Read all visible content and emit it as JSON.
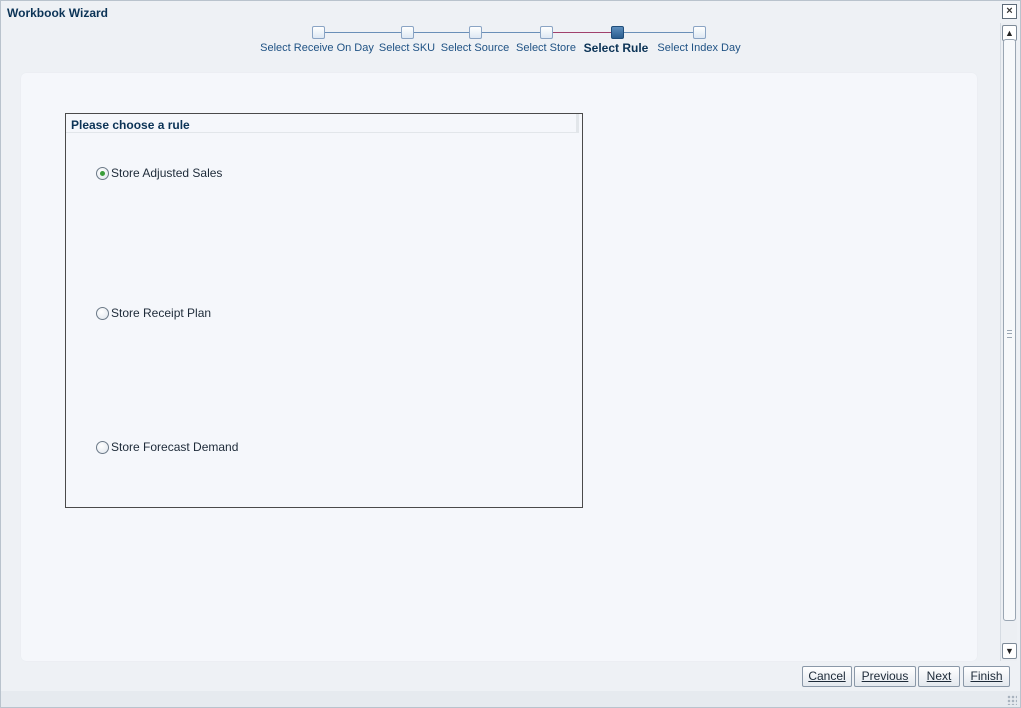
{
  "window": {
    "title": "Workbook Wizard",
    "close_glyph": "×"
  },
  "train": {
    "steps": [
      {
        "label": "Select Receive On Day",
        "current": false
      },
      {
        "label": "Select SKU",
        "current": false
      },
      {
        "label": "Select Source",
        "current": false
      },
      {
        "label": "Select Store",
        "current": false
      },
      {
        "label": "Select Rule",
        "current": true
      },
      {
        "label": "Select Index Day",
        "current": false
      }
    ]
  },
  "rule_panel": {
    "title": "Please choose a rule",
    "options": [
      {
        "label": "Store Adjusted Sales",
        "selected": true
      },
      {
        "label": "Store Receipt Plan",
        "selected": false
      },
      {
        "label": "Store Forecast Demand",
        "selected": false
      }
    ]
  },
  "buttons": {
    "cancel": "Cancel",
    "previous": "Previous",
    "next": "Next",
    "finish": "Finish"
  },
  "scrollbar": {
    "up_glyph": "▲",
    "down_glyph": "▼"
  },
  "colors": {
    "accent": "#0b3356",
    "link": "#1f5284",
    "selected_radio": "#3a9d3a",
    "active_step_line": "#a0406c"
  }
}
